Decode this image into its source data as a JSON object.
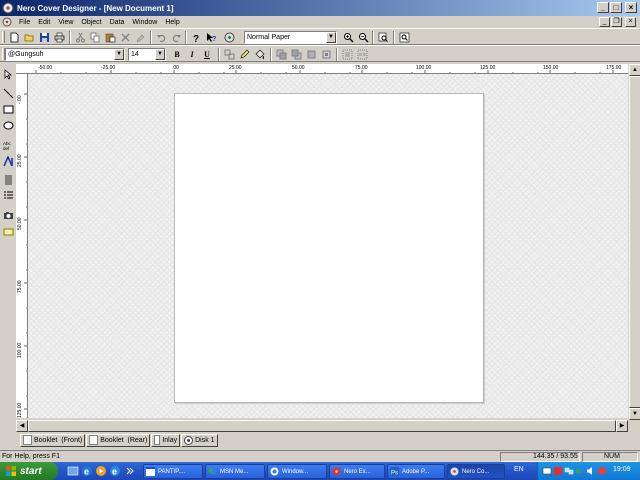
{
  "window": {
    "title": "Nero Cover Designer - [New Document 1]",
    "controls": {
      "minimize": "_",
      "maximize": "□",
      "close": "×"
    }
  },
  "menu": {
    "items": [
      "File",
      "Edit",
      "View",
      "Object",
      "Data",
      "Window",
      "Help"
    ],
    "mdi_controls": {
      "minimize": "_",
      "restore": "❐",
      "close": "×"
    }
  },
  "toolbar": {
    "paper_select": "Normal Paper",
    "font_select": "@Gungsuh",
    "size_select": "14",
    "bold": "B",
    "italic": "I",
    "underline": "U"
  },
  "ruler": {
    "horizontal": [
      "-50.00",
      "-25.00",
      ".00",
      "25.00",
      "50.00",
      "75.00",
      "100.00",
      "125.00",
      "150.00",
      "175.00"
    ],
    "vertical": [
      "-.00",
      "25.00",
      "50.00",
      "75.00",
      "100.00",
      "125.00"
    ]
  },
  "page_tabs": [
    {
      "label": "Booklet  (Front)",
      "icon": "booklet-icon"
    },
    {
      "label": "Booklet  (Rear)",
      "icon": "booklet-icon"
    },
    {
      "label": "Inlay",
      "icon": "inlay-icon"
    },
    {
      "label": "Disk 1",
      "icon": "disc-icon"
    }
  ],
  "status": {
    "help": "For Help, press F1",
    "coords": "144.35 / 93.55",
    "num": "NUM"
  },
  "taskbar": {
    "start": "start",
    "buttons": [
      "PANTIP....",
      "MSN Me...",
      "Window...",
      "Nero Ex...",
      "Adobe P...",
      "Nero Co..."
    ],
    "language": "EN",
    "clock": "19:09"
  },
  "colors": {
    "titlebar_start": "#0a246a",
    "titlebar_end": "#a6caf0",
    "chrome": "#d4d0c8",
    "taskbar": "#245edb",
    "start_button": "#3c9a3c"
  }
}
